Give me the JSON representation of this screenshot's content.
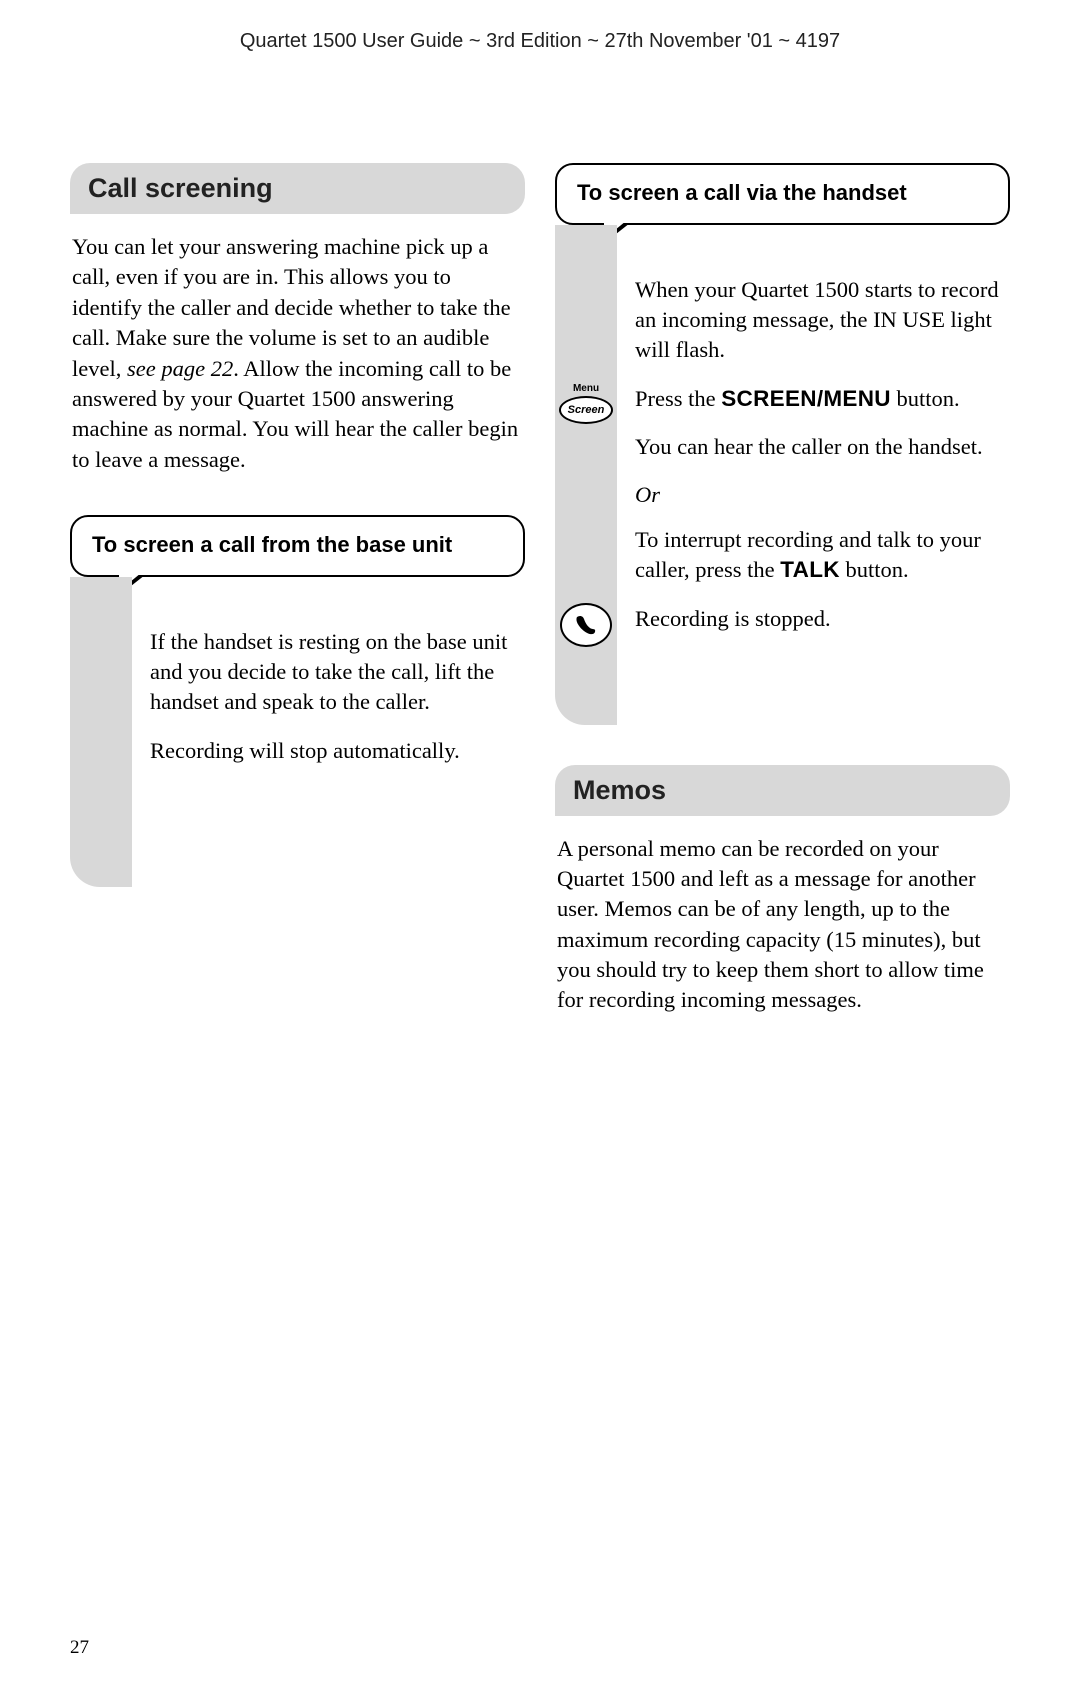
{
  "header": "Quartet 1500 User Guide ~ 3rd Edition ~ 27th November '01 ~ 4197",
  "left": {
    "section_title": "Call screening",
    "intro_p1": "You can let your answering machine pick up a call, even if you are in. This allows you to identify the caller and decide whether to take the call. Make sure the volume is set to an audible level, ",
    "intro_italic": "see page 22",
    "intro_p2": ". Allow the incoming call to be answered by your Quartet 1500 answering machine as normal. You will hear the caller begin to leave a message.",
    "callout_title": "To screen a call from the base unit",
    "step1": "If the handset is resting on the base unit and you decide to take the call, lift the handset and speak to the caller.",
    "step2": "Recording will stop automatically."
  },
  "right": {
    "callout_title": "To screen a call via the handset",
    "step1": "When your Quartet 1500 starts to record an incoming message, the IN USE light will flash.",
    "step2a": "Press the ",
    "step2_bold": "SCREEN/MENU",
    "step2b": " button.",
    "step3": "You can hear the caller on the handset.",
    "or": "Or",
    "step4a": "To interrupt recording and talk to your caller, press the ",
    "step4_bold": "TALK",
    "step4b": " button.",
    "step5": "Recording is stopped.",
    "section2_title": "Memos",
    "memos_body": "A personal memo can be recorded on your Quartet 1500 and left as a message for another user. Memos can be of any length, up to the maximum recording capacity (15 minutes), but you should try to keep them short to allow time for recording incoming messages.",
    "icon_menu_label": "Menu",
    "icon_screen_label": "Screen"
  },
  "page_number": "27"
}
